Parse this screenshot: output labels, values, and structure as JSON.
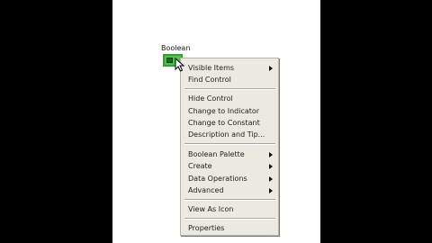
{
  "control": {
    "label": "Boolean"
  },
  "menu": {
    "items": [
      {
        "label": "Visible Items",
        "submenu": true
      },
      {
        "label": "Find Control",
        "submenu": false
      },
      {
        "label": "Hide Control",
        "submenu": false
      },
      {
        "label": "Change to Indicator",
        "submenu": false
      },
      {
        "label": "Change to Constant",
        "submenu": false
      },
      {
        "label": "Description and Tip...",
        "submenu": false
      },
      {
        "label": "Boolean Palette",
        "submenu": true
      },
      {
        "label": "Create",
        "submenu": true
      },
      {
        "label": "Data Operations",
        "submenu": true
      },
      {
        "label": "Advanced",
        "submenu": true
      },
      {
        "label": "View As Icon",
        "submenu": false
      },
      {
        "label": "Properties",
        "submenu": false
      }
    ]
  },
  "colors": {
    "control_green": "#4cc44c",
    "menu_bg": "#ece9e0",
    "background": "#000000"
  }
}
